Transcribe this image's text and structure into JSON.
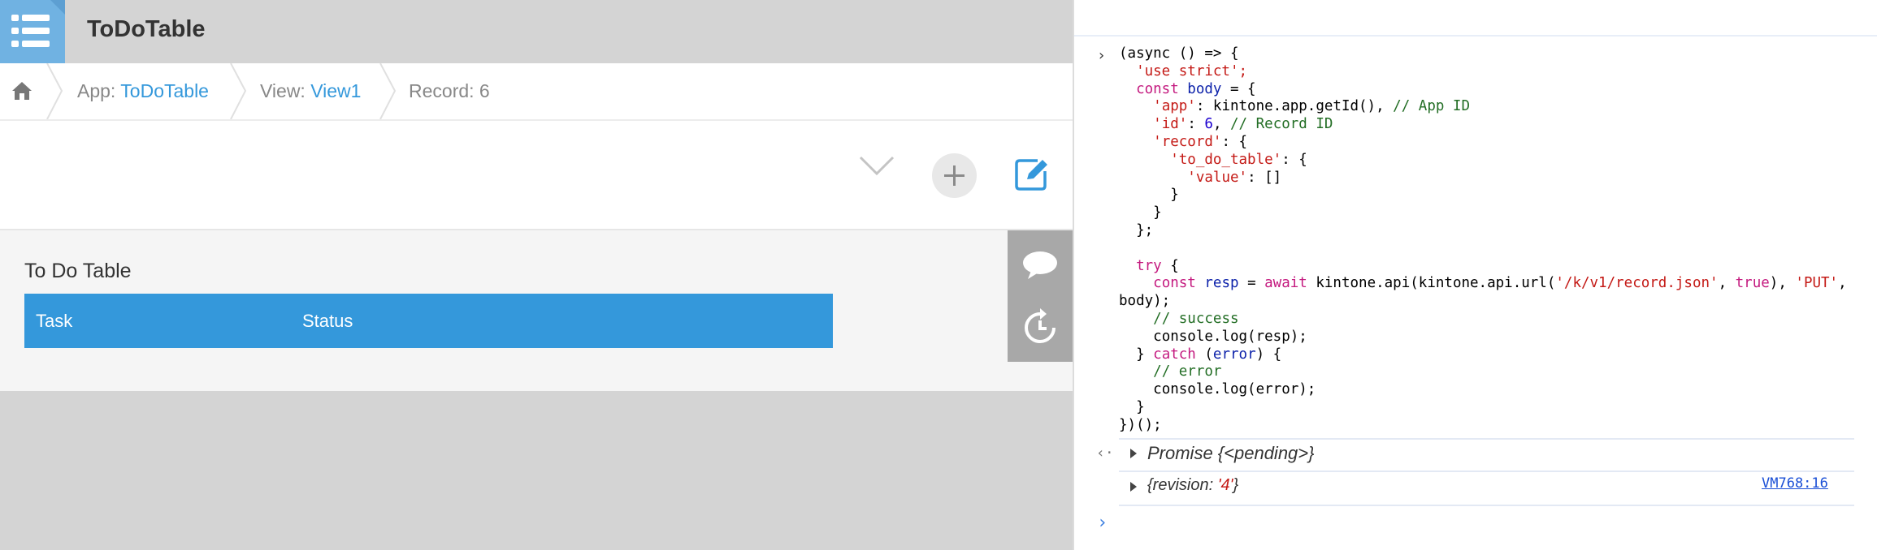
{
  "app": {
    "title": "ToDoTable",
    "breadcrumb": {
      "app_label": "App: ",
      "app_name": "ToDoTable",
      "view_label": "View: ",
      "view_name": "View1",
      "record": "Record: 6"
    },
    "record": {
      "field_label": "To Do Table",
      "columns": [
        "Task",
        "Status"
      ]
    }
  },
  "devtools": {
    "code": {
      "l1": "(async () => {",
      "l2": "'use strict';",
      "l3a": "const ",
      "l3b": "body",
      "l3c": " = {",
      "l4a": "'app'",
      "l4b": ": kintone.app.getId(), ",
      "l4c": "// App ID",
      "l5a": "'id'",
      "l5b": ": ",
      "l5c": "6",
      "l5d": ", ",
      "l5e": "// Record ID",
      "l6a": "'record'",
      "l6b": ": {",
      "l7a": "'to_do_table'",
      "l7b": ": {",
      "l8a": "'value'",
      "l8b": ": []",
      "l9": "}",
      "l10": "}",
      "l11": "};",
      "l13a": "try",
      "l13b": " {",
      "l14a": "const ",
      "l14b": "resp",
      "l14c": " = ",
      "l14d": "await",
      "l14e": " kintone.api(kintone.api.url(",
      "l14f": "'/k/v1/record.json'",
      "l14g": ", ",
      "l14h": "true",
      "l14i": "), ",
      "l14j": "'PUT'",
      "l14k": ",",
      "l15": "body);",
      "l16": "// success",
      "l17": "console.log(resp);",
      "l18a": "} ",
      "l18b": "catch",
      "l18c": " (",
      "l18d": "error",
      "l18e": ") {",
      "l19": "// error",
      "l20": "console.log(error);",
      "l21": "}",
      "l22": "})();"
    },
    "result1": "Promise {<pending>}",
    "result2_open": "{revision: ",
    "result2_val": "'4'",
    "result2_close": "}",
    "source_link": "VM768:16",
    "colors": {
      "keyword": "#c41a7f",
      "string": "#c41a16",
      "comment": "#236e25",
      "number": "#1c00cf",
      "accent": "#3498db"
    }
  }
}
